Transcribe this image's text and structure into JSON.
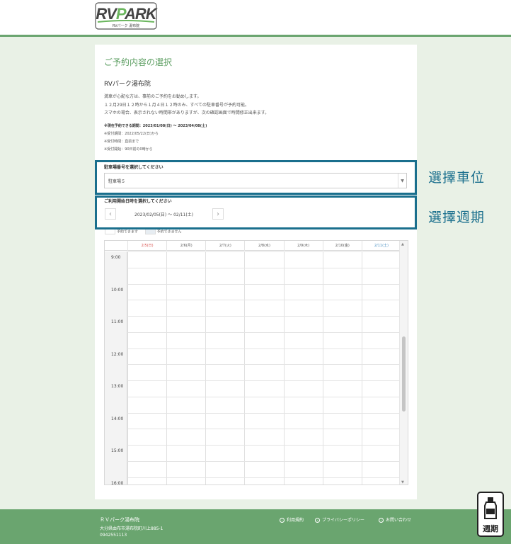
{
  "header": {
    "logo_brand": "RVPARK",
    "logo_sub": "RVパーク 湯布院"
  },
  "main": {
    "page_title": "ご予約内容の選択",
    "park_name": "RVパーク湯布院",
    "description": [
      "満車が心配な方は、事前のご予約をお勧めします。",
      "１２月29日１２時から１月４日１２時のみ、すべての駐車番号が予約可能。",
      "スマホの場合、表示されない時間帯がありますが、次の確認画面で時間修正出来ます。"
    ],
    "notes": {
      "period": "※現在予約できる期間：2023/01/08(日) 〜 2023/04/08(土)",
      "accept_period": "※受付期間：2022/05/22(日)から",
      "accept_time": "※受付時間：直前まで",
      "accept_start": "※受付開始：90日前の0時から"
    },
    "parking_select": {
      "label": "駐車場番号を選択してください",
      "value": "駐車場５"
    },
    "week_select": {
      "label": "ご利用開始日時を選択してください",
      "range": "2023/02/05(日) 〜 02/11(土)",
      "prev": "‹",
      "next": "›"
    },
    "legend": {
      "available": "予約できます",
      "unavailable": "予約できません"
    }
  },
  "calendar": {
    "days": [
      {
        "label": "2/5(日)",
        "color": "#d9534f"
      },
      {
        "label": "2/6(月)",
        "color": "#555555"
      },
      {
        "label": "2/7(火)",
        "color": "#555555"
      },
      {
        "label": "2/8(水)",
        "color": "#555555"
      },
      {
        "label": "2/9(木)",
        "color": "#555555"
      },
      {
        "label": "2/10(金)",
        "color": "#555555"
      },
      {
        "label": "2/11(土)",
        "color": "#4a90c2"
      }
    ],
    "times": [
      "9:00",
      "10:00",
      "11:00",
      "12:00",
      "13:00",
      "14:00",
      "15:00",
      "16:00"
    ]
  },
  "annotations": {
    "select_space": "選擇車位",
    "select_week": "選擇週期"
  },
  "footer": {
    "name": "ＲＶパーク湯布院",
    "address": "大分県由布市湯布院町川上885-1",
    "tel": "0942551113",
    "links": [
      "利用規約",
      "プライバシーポリシー",
      "お問い合わせ"
    ]
  },
  "stamp": {
    "text": "週期"
  },
  "colors": {
    "brand_green": "#6aa56f",
    "annotation_blue": "#1a6f8d",
    "sunday": "#d9534f",
    "saturday": "#4a90c2"
  }
}
